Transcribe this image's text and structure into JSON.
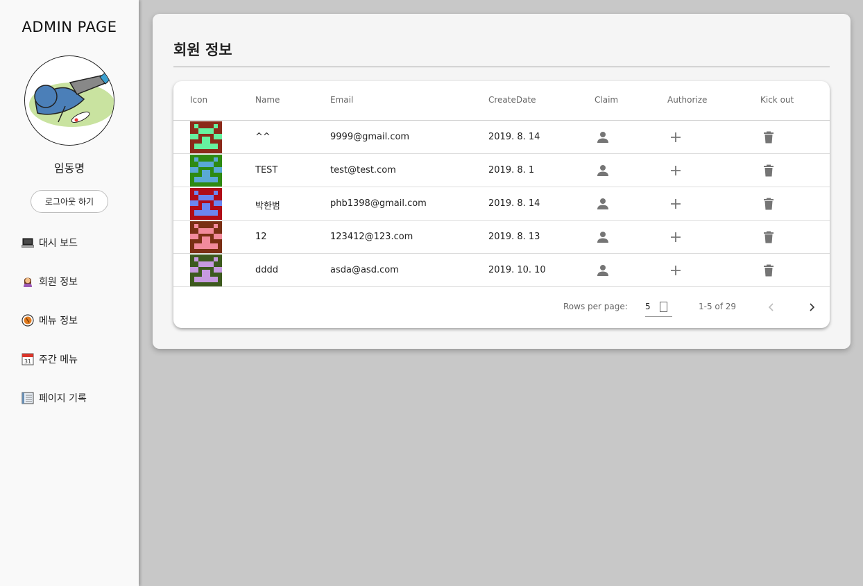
{
  "sidebar": {
    "brand": "ADMIN PAGE",
    "user_name": "임동명",
    "logout_label": "로그아웃 하기",
    "items": [
      {
        "label": "대시 보드",
        "icon": "laptop-icon"
      },
      {
        "label": "회원 정보",
        "icon": "person-icon"
      },
      {
        "label": "메뉴 정보",
        "icon": "food-icon"
      },
      {
        "label": "주간 메뉴",
        "icon": "calendar-icon"
      },
      {
        "label": "페이지 기록",
        "icon": "notebook-icon"
      }
    ],
    "calendar_day": "31"
  },
  "main": {
    "title": "회원 정보",
    "columns": [
      "Icon",
      "Name",
      "Email",
      "CreateDate",
      "Claim",
      "Authorize",
      "Kick out"
    ],
    "rows": [
      {
        "name": "^^",
        "email": "9999@gmail.com",
        "date": "2019. 8. 14",
        "icon_bg": "#8b2a1a",
        "icon_fg": "#66f2a0"
      },
      {
        "name": "TEST",
        "email": "test@test.com",
        "date": "2019. 8. 1",
        "icon_bg": "#2e8a12",
        "icon_fg": "#5aa9d6"
      },
      {
        "name": "박한범",
        "email": "phb1398@gmail.com",
        "date": "2019. 8. 14",
        "icon_bg": "#b00c18",
        "icon_fg": "#6b86f0"
      },
      {
        "name": "12",
        "email": "123412@123.com",
        "date": "2019. 8. 13",
        "icon_bg": "#7a2f14",
        "icon_fg": "#f28a9c"
      },
      {
        "name": "dddd",
        "email": "asda@asd.com",
        "date": "2019. 10. 10",
        "icon_bg": "#3d5a1e",
        "icon_fg": "#c79ae0"
      }
    ],
    "actions": {
      "claim_icon": "person-icon",
      "authorize_icon": "plus-icon",
      "kick_icon": "trash-icon"
    },
    "pagination": {
      "rows_per_page_label": "Rows per page:",
      "rows_per_page": "5",
      "range": "1-5 of 29"
    }
  },
  "colors": {
    "icon_grey": "#757575",
    "background": "#c8c8c8"
  }
}
